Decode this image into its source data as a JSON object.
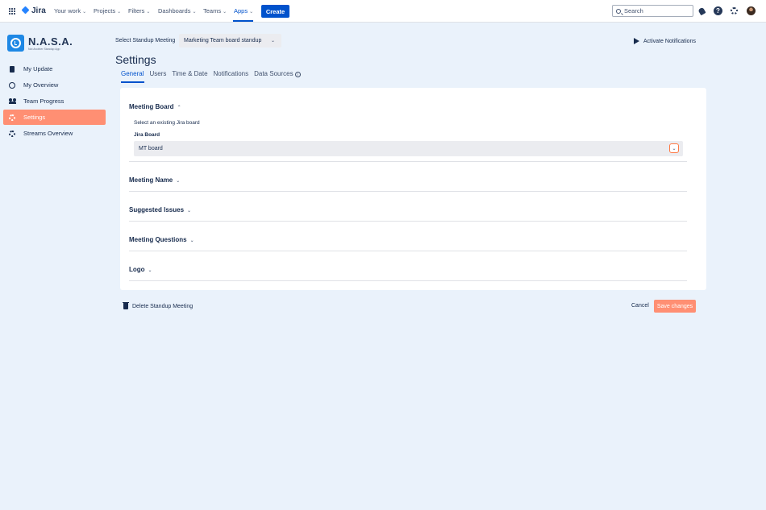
{
  "topnav": {
    "product": "Jira",
    "items": [
      {
        "label": "Your work",
        "chevron": "⌄"
      },
      {
        "label": "Projects",
        "chevron": "⌄"
      },
      {
        "label": "Filters",
        "chevron": "⌄"
      },
      {
        "label": "Dashboards",
        "chevron": "⌄"
      },
      {
        "label": "Teams",
        "chevron": "⌄"
      },
      {
        "label": "Apps",
        "chevron": "⌄"
      }
    ],
    "create_label": "Create",
    "search_placeholder": "Search"
  },
  "sidebar": {
    "logo_title": "N.A.S.A.",
    "logo_subtitle": "Not Another Standup App",
    "items": [
      {
        "label": "My Update"
      },
      {
        "label": "My Overview"
      },
      {
        "label": "Team Progress"
      },
      {
        "label": "Settings"
      },
      {
        "label": "Streams Overview"
      }
    ]
  },
  "header": {
    "standup_label": "Select Standup Meeting",
    "standup_value": "Marketing Team board standup",
    "notifications_label": "Activate Notifications"
  },
  "settings": {
    "title": "Settings",
    "tabs": [
      "General",
      "Users",
      "Time & Date",
      "Notifications",
      "Data Sources"
    ],
    "sections": {
      "meeting_board": {
        "title": "Meeting Board",
        "helper": "Select an existing Jira board",
        "field_label": "Jira Board",
        "field_value": "MT board"
      },
      "meeting_name": {
        "title": "Meeting Name"
      },
      "suggested_issues": {
        "title": "Suggested Issues"
      },
      "meeting_questions": {
        "title": "Meeting Questions"
      },
      "logo": {
        "title": "Logo"
      }
    },
    "delete_label": "Delete Standup Meeting",
    "cancel_label": "Cancel",
    "save_label": "Save changes"
  },
  "colors": {
    "accent": "#0052cc",
    "brand_orange": "#ff8f73",
    "background": "#eaf2fb"
  }
}
